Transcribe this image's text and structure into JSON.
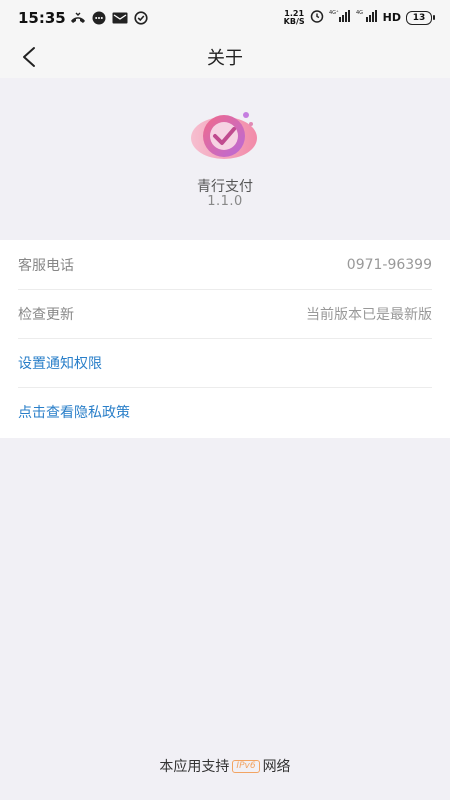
{
  "status_bar": {
    "time": "15:35",
    "net_speed_value": "1.21",
    "net_speed_unit": "KB/S",
    "signal_1": "4G",
    "signal_2": "4G",
    "hd_label": "HD",
    "battery": "13",
    "icons": [
      "missed-call-icon",
      "message-icon",
      "mail-icon",
      "check-circle-icon",
      "alarm-icon",
      "wifi-icon",
      "signal-icon",
      "signal-icon",
      "hd-icon",
      "battery-icon"
    ]
  },
  "nav": {
    "title": "关于",
    "back_icon": "back-chevron-icon"
  },
  "app": {
    "name": "青行支付",
    "version": "1.1.0",
    "logo_colors": [
      "#f16a8a",
      "#b86ad9",
      "#f5a6c0"
    ]
  },
  "info_rows": [
    {
      "label": "客服电话",
      "value": "0971-96399"
    },
    {
      "label": "检查更新",
      "value": "当前版本已是最新版"
    }
  ],
  "links": [
    {
      "label": "设置通知权限"
    },
    {
      "label": "点击查看隐私政策"
    }
  ],
  "footer": {
    "prefix": "本应用支持",
    "badge": "IPv6",
    "suffix": "网络"
  },
  "colors": {
    "link": "#2a7fc9",
    "background": "#f1f0f5",
    "badge": "#f2a463"
  }
}
